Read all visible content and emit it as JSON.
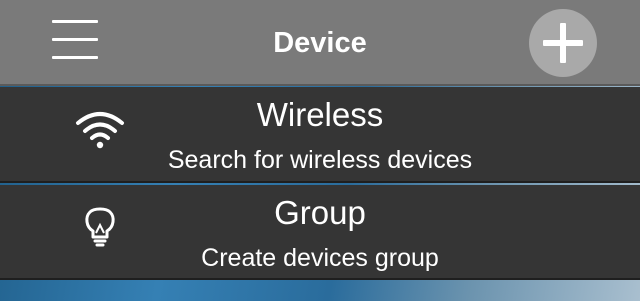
{
  "header": {
    "title": "Device",
    "menu_icon": "hamburger-menu-icon",
    "add_icon": "plus-icon"
  },
  "items": [
    {
      "title": "Wireless",
      "subtitle": "Search for wireless devices",
      "icon": "wifi-icon"
    },
    {
      "title": "Group",
      "subtitle": "Create devices group",
      "icon": "lightbulb-icon"
    }
  ],
  "colors": {
    "header_bg": "#7a7a7a",
    "item_bg": "#353535",
    "add_button_bg": "#a9a9a9",
    "text": "#ffffff"
  }
}
